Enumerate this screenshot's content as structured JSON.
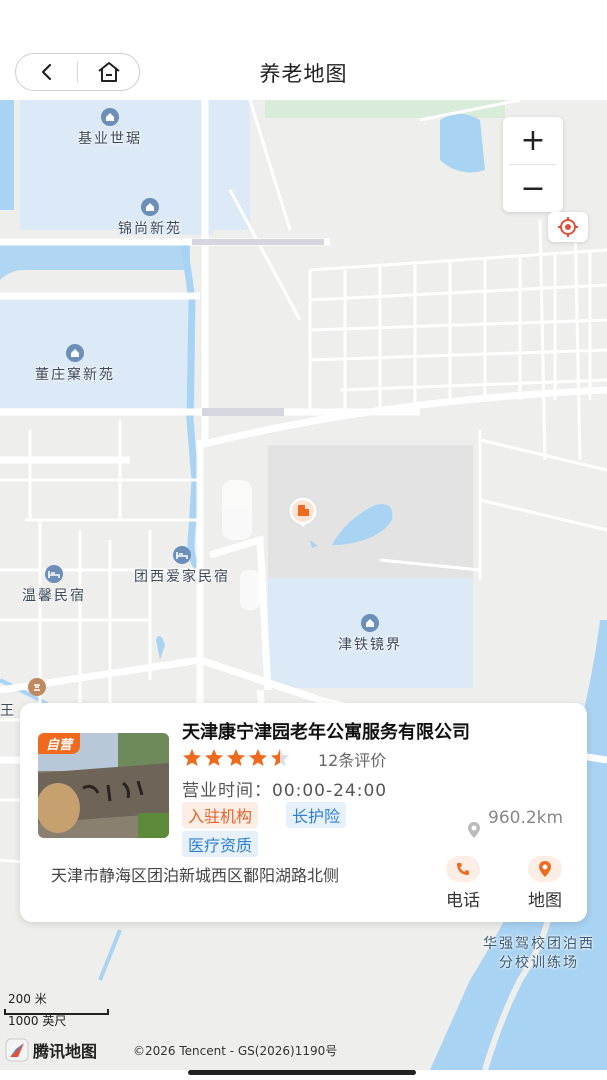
{
  "nav": {
    "title": "养老地图",
    "back_icon": "chevron-left-icon",
    "home_icon": "home-icon"
  },
  "map": {
    "zoom_in": "+",
    "zoom_out": "−",
    "pois": {
      "jiye": "基业世琚",
      "jinshang": "锦尚新苑",
      "dongzhuang": "董庄窠新苑",
      "tuanxi": "团西爱家民宿",
      "wenxin": "温馨民宿",
      "jintie": "津铁镜界",
      "huaqiang": "华强驾校团泊西分校训练场",
      "edge_left": "王窠"
    },
    "scale_metric": "200 米",
    "scale_imperial": "1000 英尺",
    "provider": "腾讯地图",
    "copyright": "©2026 Tencent - GS(2026)1190号"
  },
  "card": {
    "badge": "自营",
    "name": "天津康宁津园老年公寓服务有限公司",
    "rating": 4.5,
    "reviews": "12条评价",
    "hours": "营业时间：00:00-24:00",
    "tags": [
      "入驻机构",
      "长护险",
      "医疗资质"
    ],
    "distance": "960.2km",
    "address": "天津市静海区团泊新城西区鄱阳湖路北侧",
    "call_label": "电话",
    "map_label": "地图"
  },
  "colors": {
    "accent": "#f06a1e",
    "water": "#a9d3f2",
    "residential": "#dce9f6",
    "map_bg": "#eeeeec"
  }
}
